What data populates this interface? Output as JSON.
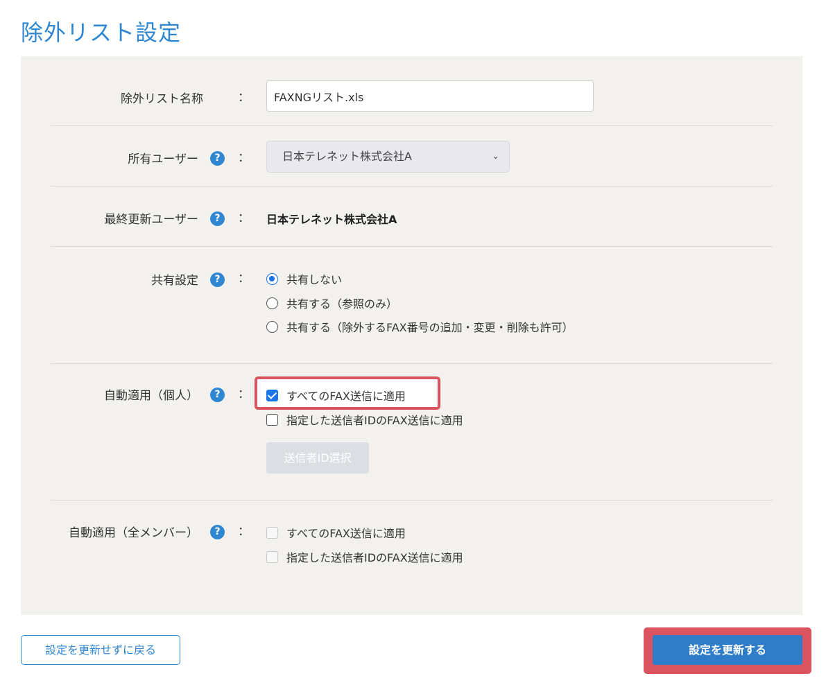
{
  "page": {
    "title": "除外リスト設定"
  },
  "form": {
    "name": {
      "label": "除外リスト名称",
      "value": "FAXNGリスト.xls"
    },
    "owner": {
      "label": "所有ユーザー",
      "selected": "日本テレネット株式会社A"
    },
    "last_updated_by": {
      "label": "最終更新ユーザー",
      "value": "日本テレネット株式会社A"
    },
    "sharing": {
      "label": "共有設定",
      "options": [
        {
          "label": "共有しない",
          "checked": true
        },
        {
          "label": "共有する（参照のみ）",
          "checked": false
        },
        {
          "label": "共有する（除外するFAX番号の追加・変更・削除も許可）",
          "checked": false
        }
      ]
    },
    "auto_personal": {
      "label": "自動適用（個人）",
      "options": [
        {
          "label": "すべてのFAX送信に適用",
          "checked": true
        },
        {
          "label": "指定した送信者IDのFAX送信に適用",
          "checked": false
        }
      ],
      "select_sender_button": "送信者ID選択"
    },
    "auto_all_members": {
      "label": "自動適用（全メンバー）",
      "options": [
        {
          "label": "すべてのFAX送信に適用",
          "checked": false,
          "disabled": true
        },
        {
          "label": "指定した送信者IDのFAX送信に適用",
          "checked": false,
          "disabled": true
        }
      ]
    },
    "colon": "：",
    "help_glyph": "?"
  },
  "footer": {
    "back_button": "設定を更新せずに戻る",
    "submit_button": "設定を更新する"
  },
  "colors": {
    "accent": "#2f86d1",
    "panel_bg": "#f2f1ee",
    "highlight": "#d9545f",
    "radio_check": "#1a73e8"
  }
}
